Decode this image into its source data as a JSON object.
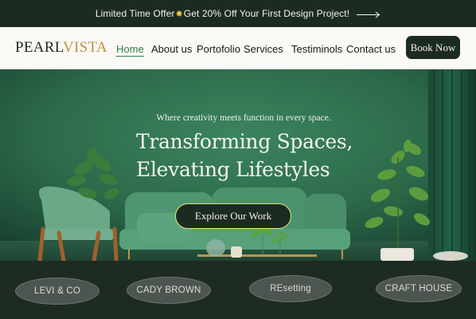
{
  "promo": {
    "text_before": "Limited Time Offer",
    "spark_glyph": "✸",
    "text_after": " Get 20% Off Your First Design Project!",
    "arrow_icon": "long-arrow-right-icon"
  },
  "header": {
    "logo_part1": "PEARL",
    "logo_part2": "VISTA",
    "nav": [
      {
        "label": "Home",
        "active": true
      },
      {
        "label": "About us"
      },
      {
        "label": "Portofolio"
      },
      {
        "label": "Services"
      },
      {
        "label": "Testiminols"
      },
      {
        "label": "Contact us"
      }
    ],
    "cta_label": "Book Now"
  },
  "hero": {
    "tagline": "Where creativity meets function in every space.",
    "headline_line1": "Transforming Spaces,",
    "headline_line2": "Elevating Lifestyles",
    "cta_label": "Explore Our Work"
  },
  "clients": [
    {
      "name": "LEVI & CO"
    },
    {
      "name": "CADY BROWN"
    },
    {
      "name": "REsetting"
    },
    {
      "name": "CRAFT HOUSE"
    }
  ],
  "colors": {
    "dark_green": "#1c2b22",
    "wall_green": "#2f6e4e",
    "accent_gold": "#bd9344",
    "button_outline": "#e6e86e"
  }
}
